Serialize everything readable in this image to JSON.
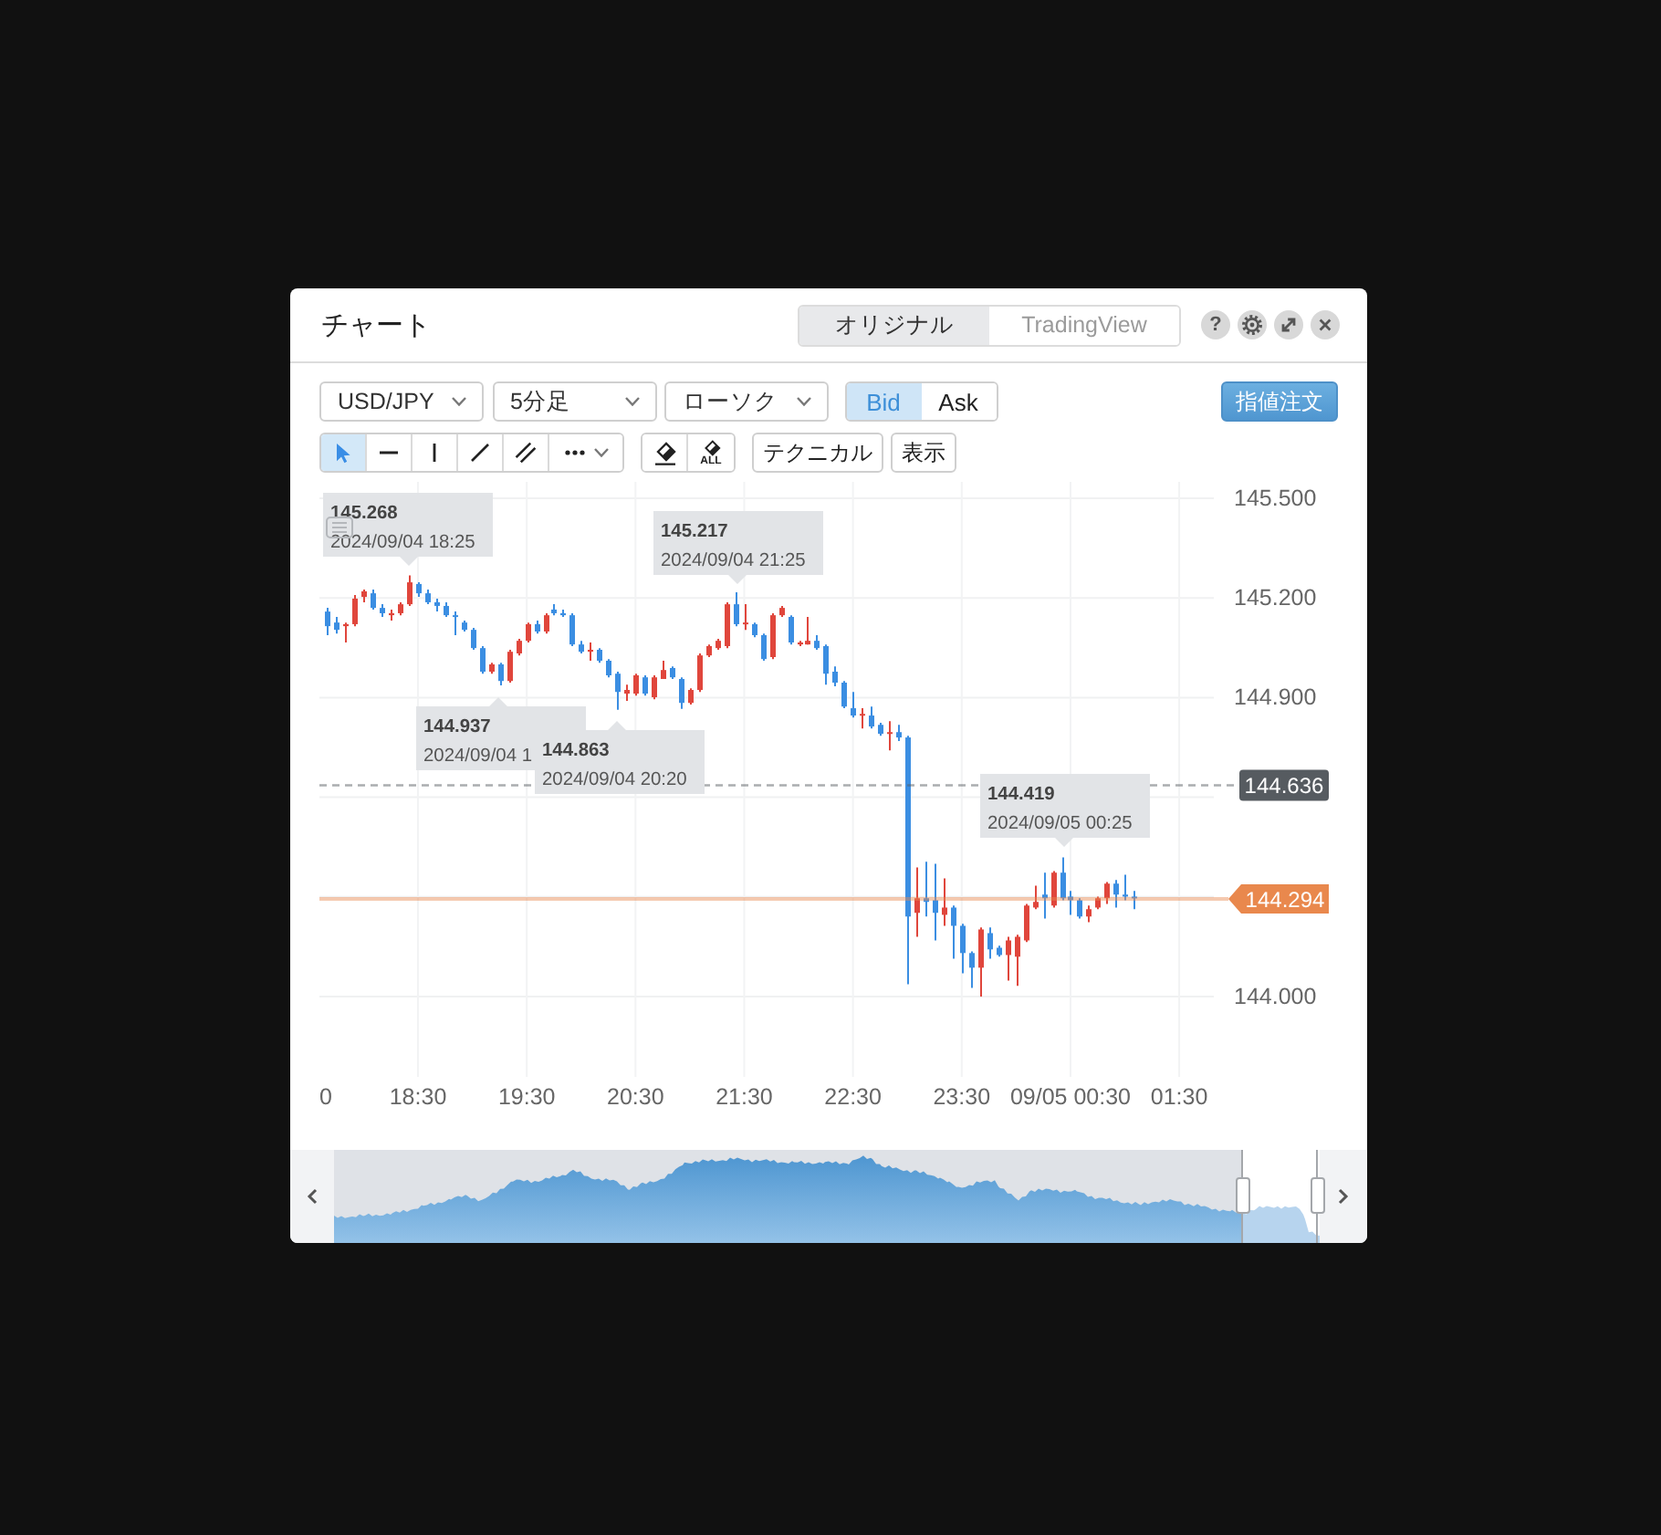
{
  "window": {
    "title": "チャート"
  },
  "view_tabs": [
    {
      "label": "オリジナル",
      "selected": true
    },
    {
      "label": "TradingView",
      "selected": false
    }
  ],
  "help_button": {
    "label": "?"
  },
  "toolbar": {
    "dropdowns": [
      {
        "value": "USD/JPY"
      },
      {
        "value": "5分足"
      },
      {
        "value": "ローソク"
      }
    ],
    "price_sides": [
      {
        "label": "Bid",
        "selected": true
      },
      {
        "label": "Ask",
        "selected": false
      }
    ],
    "order_button": {
      "label": "指値注文"
    }
  },
  "drawing_tools": [
    {
      "kind": "cursor",
      "selected": true
    },
    {
      "kind": "horizontal_line",
      "selected": false
    },
    {
      "kind": "vertical_line",
      "selected": false
    },
    {
      "kind": "trend_line",
      "selected": false
    },
    {
      "kind": "parallel_lines",
      "selected": false
    },
    {
      "kind": "more",
      "selected": false
    }
  ],
  "erase_tools": [
    {
      "kind": "erase"
    },
    {
      "kind": "erase_all",
      "label": "ALL"
    }
  ],
  "menu_buttons": [
    {
      "label": "テクニカル"
    },
    {
      "label": "表示"
    }
  ],
  "chart": {
    "chart_data": {
      "type": "candlestick",
      "x": [
        "2024-09-04 17:40",
        "2024-09-04 17:45",
        "2024-09-04 17:50",
        "2024-09-04 17:55",
        "2024-09-04 18:00",
        "2024-09-04 18:05",
        "2024-09-04 18:10",
        "2024-09-04 18:15",
        "2024-09-04 18:20",
        "2024-09-04 18:25",
        "2024-09-04 18:30",
        "2024-09-04 18:35",
        "2024-09-04 18:40",
        "2024-09-04 18:45",
        "2024-09-04 18:50",
        "2024-09-04 18:55",
        "2024-09-04 19:00",
        "2024-09-04 19:05",
        "2024-09-04 19:10",
        "2024-09-04 19:15",
        "2024-09-04 19:20",
        "2024-09-04 19:25",
        "2024-09-04 19:30",
        "2024-09-04 19:35",
        "2024-09-04 19:40",
        "2024-09-04 19:45",
        "2024-09-04 19:50",
        "2024-09-04 19:55",
        "2024-09-04 20:00",
        "2024-09-04 20:05",
        "2024-09-04 20:10",
        "2024-09-04 20:15",
        "2024-09-04 20:20",
        "2024-09-04 20:25",
        "2024-09-04 20:30",
        "2024-09-04 20:35",
        "2024-09-04 20:40",
        "2024-09-04 20:45",
        "2024-09-04 20:50",
        "2024-09-04 20:55",
        "2024-09-04 21:00",
        "2024-09-04 21:05",
        "2024-09-04 21:10",
        "2024-09-04 21:15",
        "2024-09-04 21:20",
        "2024-09-04 21:25",
        "2024-09-04 21:30",
        "2024-09-04 21:35",
        "2024-09-04 21:40",
        "2024-09-04 21:45",
        "2024-09-04 21:50",
        "2024-09-04 21:55",
        "2024-09-04 22:00",
        "2024-09-04 22:05",
        "2024-09-04 22:10",
        "2024-09-04 22:15",
        "2024-09-04 22:20",
        "2024-09-04 22:25",
        "2024-09-04 22:30",
        "2024-09-04 22:35",
        "2024-09-04 22:40",
        "2024-09-04 22:45",
        "2024-09-04 22:50",
        "2024-09-04 22:55",
        "2024-09-04 23:00",
        "2024-09-04 23:05",
        "2024-09-04 23:10",
        "2024-09-04 23:15",
        "2024-09-04 23:20",
        "2024-09-04 23:25",
        "2024-09-04 23:30",
        "2024-09-04 23:35",
        "2024-09-04 23:40",
        "2024-09-04 23:45",
        "2024-09-04 23:50",
        "2024-09-04 23:55",
        "2024-09-05 00:00",
        "2024-09-05 00:05",
        "2024-09-05 00:10",
        "2024-09-05 00:15",
        "2024-09-05 00:20",
        "2024-09-05 00:25",
        "2024-09-05 00:30",
        "2024-09-05 00:35",
        "2024-09-05 00:40",
        "2024-09-05 00:45",
        "2024-09-05 00:50",
        "2024-09-05 00:55",
        "2024-09-05 01:00",
        "2024-09-05 01:05"
      ],
      "ohlc": [
        [
          145.159,
          145.17,
          145.088,
          145.115
        ],
        [
          145.126,
          145.143,
          145.093,
          145.104
        ],
        [
          145.115,
          145.126,
          145.066,
          145.121
        ],
        [
          145.121,
          145.209,
          145.115,
          145.198
        ],
        [
          145.203,
          145.225,
          145.187,
          145.22
        ],
        [
          145.214,
          145.225,
          145.165,
          145.17
        ],
        [
          145.17,
          145.181,
          145.143,
          145.154
        ],
        [
          145.148,
          145.165,
          145.132,
          145.154
        ],
        [
          145.154,
          145.187,
          145.148,
          145.181
        ],
        [
          145.181,
          145.268,
          145.176,
          145.247
        ],
        [
          145.242,
          145.247,
          145.203,
          145.214
        ],
        [
          145.214,
          145.225,
          145.181,
          145.187
        ],
        [
          145.187,
          145.198,
          145.159,
          145.176
        ],
        [
          145.176,
          145.187,
          145.143,
          145.148
        ],
        [
          145.148,
          145.159,
          145.088,
          145.143
        ],
        [
          145.126,
          145.132,
          145.099,
          145.104
        ],
        [
          145.104,
          145.11,
          145.044,
          145.049
        ],
        [
          145.049,
          145.055,
          144.972,
          144.978
        ],
        [
          144.978,
          145.005,
          144.972,
          145.0
        ],
        [
          145.0,
          145.005,
          144.937,
          144.95
        ],
        [
          144.95,
          145.044,
          144.945,
          145.038
        ],
        [
          145.033,
          145.077,
          145.027,
          145.071
        ],
        [
          145.071,
          145.126,
          145.066,
          145.121
        ],
        [
          145.121,
          145.132,
          145.093,
          145.099
        ],
        [
          145.099,
          145.154,
          145.093,
          145.148
        ],
        [
          145.165,
          145.181,
          145.148,
          145.154
        ],
        [
          145.154,
          145.165,
          145.143,
          145.148
        ],
        [
          145.148,
          145.154,
          145.055,
          145.06
        ],
        [
          145.06,
          145.071,
          145.033,
          145.038
        ],
        [
          145.038,
          145.066,
          145.011,
          145.044
        ],
        [
          145.044,
          145.049,
          145.005,
          145.011
        ],
        [
          145.011,
          145.016,
          144.961,
          144.967
        ],
        [
          144.972,
          144.978,
          144.863,
          144.917
        ],
        [
          144.912,
          144.939,
          144.89,
          144.923
        ],
        [
          144.912,
          144.972,
          144.906,
          144.967
        ],
        [
          144.961,
          144.967,
          144.906,
          144.912
        ],
        [
          144.901,
          144.967,
          144.895,
          144.961
        ],
        [
          144.956,
          145.011,
          144.956,
          144.983
        ],
        [
          144.989,
          144.994,
          144.956,
          144.961
        ],
        [
          144.956,
          144.961,
          144.866,
          144.884
        ],
        [
          144.884,
          144.928,
          144.879,
          144.923
        ],
        [
          144.923,
          145.033,
          144.917,
          145.027
        ],
        [
          145.027,
          145.06,
          145.022,
          145.055
        ],
        [
          145.049,
          145.077,
          145.044,
          145.071
        ],
        [
          145.055,
          145.187,
          145.049,
          145.181
        ],
        [
          145.181,
          145.217,
          145.115,
          145.121
        ],
        [
          145.121,
          145.181,
          145.104,
          145.126
        ],
        [
          145.121,
          145.126,
          145.082,
          145.088
        ],
        [
          145.088,
          145.093,
          145.011,
          145.016
        ],
        [
          145.022,
          145.154,
          145.016,
          145.148
        ],
        [
          145.148,
          145.176,
          145.143,
          145.17
        ],
        [
          145.143,
          145.148,
          145.06,
          145.066
        ],
        [
          145.06,
          145.071,
          145.055,
          145.066
        ],
        [
          145.06,
          145.143,
          145.06,
          145.071
        ],
        [
          145.071,
          145.088,
          145.044,
          145.049
        ],
        [
          145.055,
          145.06,
          144.939,
          144.972
        ],
        [
          144.978,
          144.994,
          144.934,
          144.945
        ],
        [
          144.945,
          144.95,
          144.868,
          144.873
        ],
        [
          144.868,
          144.917,
          144.84,
          144.846
        ],
        [
          144.846,
          144.868,
          144.807,
          144.851
        ],
        [
          144.846,
          144.873,
          144.807,
          144.813
        ],
        [
          144.818,
          144.824,
          144.785,
          144.791
        ],
        [
          144.791,
          144.829,
          144.741,
          144.796
        ],
        [
          144.796,
          144.818,
          144.769,
          144.78
        ],
        [
          144.78,
          144.785,
          144.037,
          144.241
        ],
        [
          144.252,
          144.389,
          144.18,
          144.296
        ],
        [
          144.296,
          144.406,
          144.241,
          144.285
        ],
        [
          144.29,
          144.4,
          144.169,
          144.252
        ],
        [
          144.246,
          144.356,
          144.213,
          144.268
        ],
        [
          144.268,
          144.274,
          144.114,
          144.213
        ],
        [
          144.213,
          144.219,
          144.07,
          144.131
        ],
        [
          144.131,
          144.136,
          144.026,
          144.087
        ],
        [
          144.087,
          144.208,
          144.0,
          144.202
        ],
        [
          144.191,
          144.208,
          144.114,
          144.142
        ],
        [
          144.147,
          144.153,
          144.12,
          144.125
        ],
        [
          144.125,
          144.18,
          144.048,
          144.169
        ],
        [
          144.12,
          144.186,
          144.032,
          144.18
        ],
        [
          144.169,
          144.279,
          144.164,
          144.274
        ],
        [
          144.268,
          144.334,
          144.263,
          144.285
        ],
        [
          144.307,
          144.373,
          144.235,
          144.296
        ],
        [
          144.274,
          144.378,
          144.268,
          144.373
        ],
        [
          144.373,
          144.419,
          144.29,
          144.296
        ],
        [
          144.301,
          144.318,
          144.246,
          144.29
        ],
        [
          144.29,
          144.296,
          144.235,
          144.241
        ],
        [
          144.241,
          144.274,
          144.224,
          144.263
        ],
        [
          144.268,
          144.301,
          144.263,
          144.296
        ],
        [
          144.296,
          144.345,
          144.279,
          144.34
        ],
        [
          144.34,
          144.351,
          144.268,
          144.307
        ],
        [
          144.307,
          144.367,
          144.29,
          144.301
        ],
        [
          144.301,
          144.318,
          144.263,
          144.296
        ]
      ],
      "xlim": [
        "2024-09-04 17:35",
        "2024-09-05 01:50"
      ],
      "ylim": [
        144.0,
        145.5
      ],
      "xticks": [
        {
          "value": "2024-09-04 18:30",
          "label": "18:30"
        },
        {
          "value": "2024-09-04 19:30",
          "label": "19:30"
        },
        {
          "value": "2024-09-04 20:30",
          "label": "20:30"
        },
        {
          "value": "2024-09-04 21:30",
          "label": "21:30"
        },
        {
          "value": "2024-09-04 22:30",
          "label": "22:30"
        },
        {
          "value": "2024-09-04 23:30",
          "label": "23:30"
        },
        {
          "value": "2024-09-05 00:30",
          "label": "09/05 00:30"
        },
        {
          "value": "2024-09-05 01:30",
          "label": "01:30"
        }
      ],
      "yticks": [
        {
          "value": 144.0,
          "label": "144.000"
        },
        {
          "value": 144.9,
          "label": "144.900"
        },
        {
          "value": 145.2,
          "label": "145.200"
        },
        {
          "value": 145.5,
          "label": "145.500"
        }
      ],
      "grid": true,
      "ref_lines": [
        {
          "axis": "y",
          "value": 144.636,
          "label": "144.636",
          "color": "#565b60"
        },
        {
          "axis": "y",
          "value": 144.294,
          "label": "144.294",
          "color": "#e9884d"
        }
      ]
    },
    "clipped_x_label": "0",
    "tooltips": [
      {
        "kind": "high",
        "price": "145.268",
        "time": "2024/09/04 18:25"
      },
      {
        "kind": "low",
        "price": "144.937",
        "time": "2024/09/04 1"
      },
      {
        "kind": "low",
        "price": "144.863",
        "time": "2024/09/04 20:20"
      },
      {
        "kind": "high",
        "price": "145.217",
        "time": "2024/09/04 21:25"
      },
      {
        "kind": "high",
        "price": "144.419",
        "time": "2024/09/05 00:25"
      }
    ]
  }
}
